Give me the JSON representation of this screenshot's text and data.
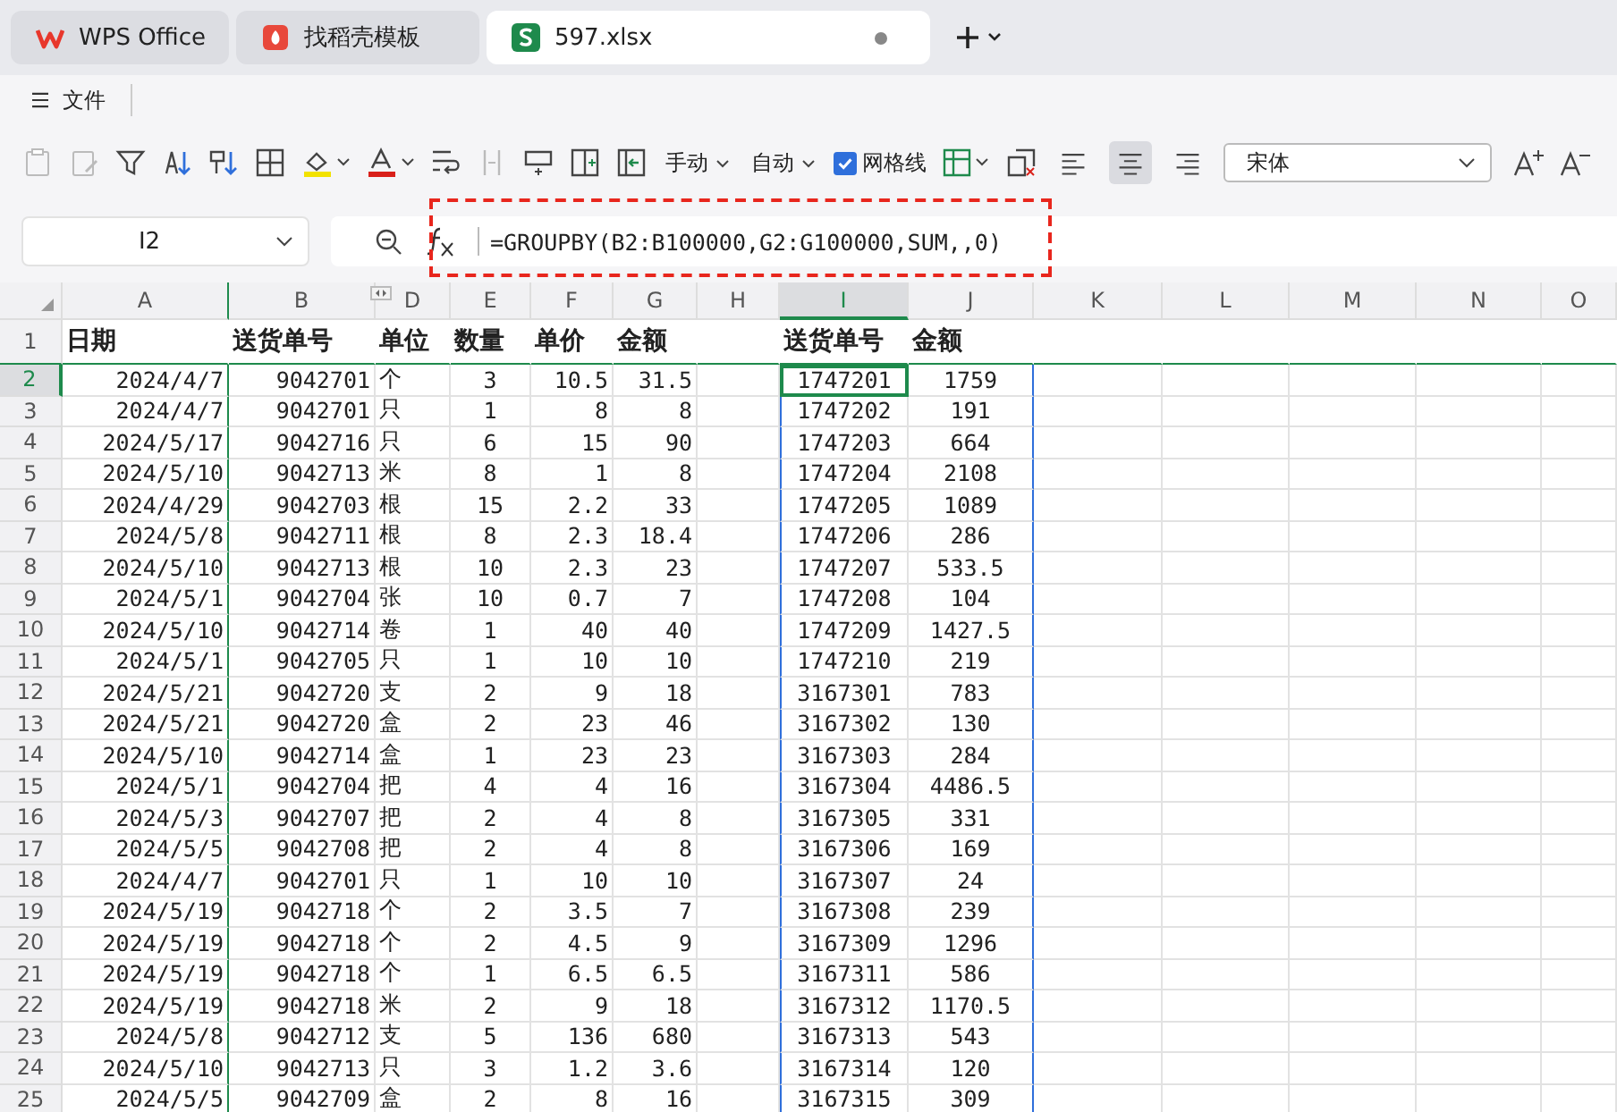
{
  "tabs": [
    {
      "label": "WPS Office",
      "kind": "home",
      "selected": false
    },
    {
      "label": "找稻壳模板",
      "kind": "template",
      "selected": false
    },
    {
      "label": "597.xlsx",
      "kind": "sheet",
      "selected": true
    }
  ],
  "menu": {
    "label": "文件"
  },
  "toolbar": {
    "calc_mode": "手动",
    "auto_label": "自动",
    "gridlines": {
      "label": "网格线",
      "checked": true
    },
    "font": "宋体",
    "align": [
      {
        "selected": false
      },
      {
        "selected": true
      },
      {
        "selected": false
      }
    ]
  },
  "formula_bar": {
    "name_box": "I2",
    "formula": "=GROUPBY(B2:B100000,G2:G100000,SUM,,0)"
  },
  "columns": [
    {
      "label": "A",
      "selected": false
    },
    {
      "label": "B",
      "selected": false
    },
    {
      "label": "D",
      "selected": false
    },
    {
      "label": "E",
      "selected": false
    },
    {
      "label": "F",
      "selected": false
    },
    {
      "label": "G",
      "selected": false
    },
    {
      "label": "H",
      "selected": false
    },
    {
      "label": "I",
      "selected": true
    },
    {
      "label": "J",
      "selected": false
    },
    {
      "label": "K",
      "selected": false
    },
    {
      "label": "L",
      "selected": false
    },
    {
      "label": "M",
      "selected": false
    },
    {
      "label": "N",
      "selected": false
    },
    {
      "label": "O",
      "selected": false
    }
  ],
  "header_row": {
    "num": "1",
    "cells": [
      "日期",
      "送货单号",
      "单位",
      "数量",
      "单价",
      "金额",
      "送货单号",
      "金额"
    ]
  },
  "rows": [
    {
      "num": "2",
      "selected": true,
      "cells": [
        "2024/4/7",
        "9042701",
        "个",
        "3",
        "10.5",
        "31.5",
        "1747201",
        "1759"
      ]
    },
    {
      "num": "3",
      "selected": false,
      "cells": [
        "2024/4/7",
        "9042701",
        "只",
        "1",
        "8",
        "8",
        "1747202",
        "191"
      ]
    },
    {
      "num": "4",
      "selected": false,
      "cells": [
        "2024/5/17",
        "9042716",
        "只",
        "6",
        "15",
        "90",
        "1747203",
        "664"
      ]
    },
    {
      "num": "5",
      "selected": false,
      "cells": [
        "2024/5/10",
        "9042713",
        "米",
        "8",
        "1",
        "8",
        "1747204",
        "2108"
      ]
    },
    {
      "num": "6",
      "selected": false,
      "cells": [
        "2024/4/29",
        "9042703",
        "根",
        "15",
        "2.2",
        "33",
        "1747205",
        "1089"
      ]
    },
    {
      "num": "7",
      "selected": false,
      "cells": [
        "2024/5/8",
        "9042711",
        "根",
        "8",
        "2.3",
        "18.4",
        "1747206",
        "286"
      ]
    },
    {
      "num": "8",
      "selected": false,
      "cells": [
        "2024/5/10",
        "9042713",
        "根",
        "10",
        "2.3",
        "23",
        "1747207",
        "533.5"
      ]
    },
    {
      "num": "9",
      "selected": false,
      "cells": [
        "2024/5/1",
        "9042704",
        "张",
        "10",
        "0.7",
        "7",
        "1747208",
        "104"
      ]
    },
    {
      "num": "10",
      "selected": false,
      "cells": [
        "2024/5/10",
        "9042714",
        "卷",
        "1",
        "40",
        "40",
        "1747209",
        "1427.5"
      ]
    },
    {
      "num": "11",
      "selected": false,
      "cells": [
        "2024/5/1",
        "9042705",
        "只",
        "1",
        "10",
        "10",
        "1747210",
        "219"
      ]
    },
    {
      "num": "12",
      "selected": false,
      "cells": [
        "2024/5/21",
        "9042720",
        "支",
        "2",
        "9",
        "18",
        "3167301",
        "783"
      ]
    },
    {
      "num": "13",
      "selected": false,
      "cells": [
        "2024/5/21",
        "9042720",
        "盒",
        "2",
        "23",
        "46",
        "3167302",
        "130"
      ]
    },
    {
      "num": "14",
      "selected": false,
      "cells": [
        "2024/5/10",
        "9042714",
        "盒",
        "1",
        "23",
        "23",
        "3167303",
        "284"
      ]
    },
    {
      "num": "15",
      "selected": false,
      "cells": [
        "2024/5/1",
        "9042704",
        "把",
        "4",
        "4",
        "16",
        "3167304",
        "4486.5"
      ]
    },
    {
      "num": "16",
      "selected": false,
      "cells": [
        "2024/5/3",
        "9042707",
        "把",
        "2",
        "4",
        "8",
        "3167305",
        "331"
      ]
    },
    {
      "num": "17",
      "selected": false,
      "cells": [
        "2024/5/5",
        "9042708",
        "把",
        "2",
        "4",
        "8",
        "3167306",
        "169"
      ]
    },
    {
      "num": "18",
      "selected": false,
      "cells": [
        "2024/4/7",
        "9042701",
        "只",
        "1",
        "10",
        "10",
        "3167307",
        "24"
      ]
    },
    {
      "num": "19",
      "selected": false,
      "cells": [
        "2024/5/19",
        "9042718",
        "个",
        "2",
        "3.5",
        "7",
        "3167308",
        "239"
      ]
    },
    {
      "num": "20",
      "selected": false,
      "cells": [
        "2024/5/19",
        "9042718",
        "个",
        "2",
        "4.5",
        "9",
        "3167309",
        "1296"
      ]
    },
    {
      "num": "21",
      "selected": false,
      "cells": [
        "2024/5/19",
        "9042718",
        "个",
        "1",
        "6.5",
        "6.5",
        "3167311",
        "586"
      ]
    },
    {
      "num": "22",
      "selected": false,
      "cells": [
        "2024/5/19",
        "9042718",
        "米",
        "2",
        "9",
        "18",
        "3167312",
        "1170.5"
      ]
    },
    {
      "num": "23",
      "selected": false,
      "cells": [
        "2024/5/8",
        "9042712",
        "支",
        "5",
        "136",
        "680",
        "3167313",
        "543"
      ]
    },
    {
      "num": "24",
      "selected": false,
      "cells": [
        "2024/5/10",
        "9042713",
        "只",
        "3",
        "1.2",
        "3.6",
        "3167314",
        "120"
      ]
    },
    {
      "num": "25",
      "selected": false,
      "cells": [
        "2024/5/5",
        "9042709",
        "盒",
        "2",
        "8",
        "16",
        "3167315",
        "309"
      ]
    }
  ]
}
